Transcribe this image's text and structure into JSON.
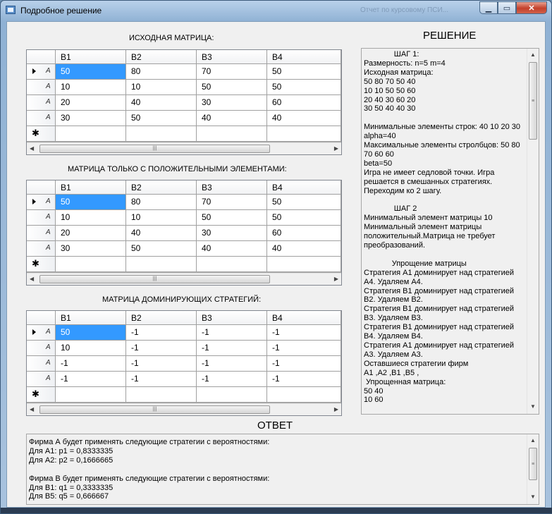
{
  "window": {
    "title": "Подробное решение",
    "background_title": "Отчет по курсовому ПСИ...",
    "minimize_label": "0",
    "maximize_label": "1",
    "close_label": "X"
  },
  "labels": {
    "source_matrix": "ИСХОДНАЯ МАТРИЦА:",
    "positive_matrix": "МАТРИЦА ТОЛЬКО С ПОЛОЖИТЕЛЬНЫМИ ЭЛЕМЕНТАМИ:",
    "dominating_matrix": "МАТРИЦА ДОМИНИРУЮЩИХ СТРАТЕГИЙ:",
    "solution": "РЕШЕНИЕ",
    "answer": "ОТВЕТ"
  },
  "grids": {
    "columns": [
      "B1",
      "B2",
      "B3",
      "B4"
    ],
    "row_marker": "A",
    "new_row_marker": "✱",
    "source_rows": [
      [
        "50",
        "80",
        "70",
        "50"
      ],
      [
        "10",
        "10",
        "50",
        "50"
      ],
      [
        "20",
        "40",
        "30",
        "60"
      ],
      [
        "30",
        "50",
        "40",
        "40"
      ]
    ],
    "positive_rows": [
      [
        "50",
        "80",
        "70",
        "50"
      ],
      [
        "10",
        "10",
        "50",
        "50"
      ],
      [
        "20",
        "40",
        "30",
        "60"
      ],
      [
        "30",
        "50",
        "40",
        "40"
      ]
    ],
    "dominating_rows": [
      [
        "50",
        "-1",
        "-1",
        "-1"
      ],
      [
        "10",
        "-1",
        "-1",
        "-1"
      ],
      [
        "-1",
        "-1",
        "-1",
        "-1"
      ],
      [
        "-1",
        "-1",
        "-1",
        "-1"
      ]
    ]
  },
  "solution_text": [
    "              ШАГ 1:",
    "Размерность: n=5 m=4",
    "Исходная матрица:",
    "50 80 70 50 40",
    "10 10 50 50 60",
    "20 40 30 60 20",
    "30 50 40 40 30",
    "",
    "Минимальные элементы строк: 40 10 20 30",
    "alpha=40",
    "Максимальные элементы стролбцов: 50 80",
    "70 60 60",
    "beta=50",
    "Игра не имеет седловой точки. Игра",
    "решается в смешанных стратегиях.",
    "Переходим ко 2 шагу.",
    "",
    "              ШАГ 2",
    "Минимальный элемент матрицы 10",
    "Минимальный элемент матрицы",
    "положительный.Матрица не требует",
    "преобразований.",
    "",
    "             Упрощение матрицы",
    "Стратегия А1 доминирует над стратегией",
    "А4. Удаляем А4.",
    "Стратегия В1 доминирует над стратегией",
    "В2. Удаляем В2.",
    "Стратегия В1 доминирует над стратегией",
    "В3. Удаляем В3.",
    "Стратегия В1 доминирует над стратегией",
    "В4. Удаляем В4.",
    "Стратегия А1 доминирует над стратегией",
    "А3. Удаляем А3.",
    "Оставшиеся стратегии фирм",
    "А1 ,А2 ,В1 ,В5 ,",
    " Упрощенная матрица:",
    "50 40",
    "10 60"
  ],
  "answer_text": [
    "Фирма А будет применять следующие стратегии с вероятностями:",
    "Для А1: p1 = 0,8333335",
    "Для А2: p2 = 0,1666665",
    "",
    "Фирма В будет применять следующие стратегии с вероятностями:",
    "Для В1: q1 = 0,3333335",
    "Для В5: q5 = 0,666667"
  ],
  "colors": {
    "selection": "#3399ff",
    "grid_background": "#ababab",
    "form_background": "#f0f0f0"
  }
}
